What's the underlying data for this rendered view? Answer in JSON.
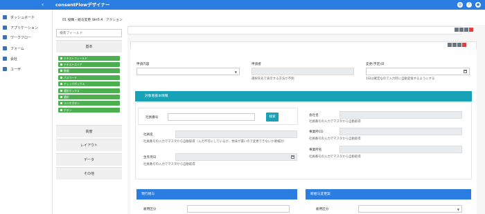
{
  "app": {
    "title": "consentFlowデザイナー"
  },
  "sidebar": {
    "items": [
      {
        "label": "ダッシュボード"
      },
      {
        "label": "アプリケーション"
      },
      {
        "label": "ワークフロー"
      },
      {
        "label": "フォーム"
      },
      {
        "label": "会社"
      },
      {
        "label": "ユーザ"
      }
    ]
  },
  "breadcrumb": {
    "form_name": "01 役職・給与変更 Ver0.4",
    "action": "アクション"
  },
  "palette": {
    "search_placeholder": "検索フィールド",
    "sections": {
      "basic": "基本",
      "advanced": "高度",
      "layout": "レイアウト",
      "data": "データ",
      "other": "その他"
    },
    "tools": [
      "テキストフィールド",
      "テキストエリア",
      "数値",
      "パスワード",
      "チェックボックス",
      "選択ボックス",
      "選択",
      "ラジオボタン",
      "ボタン"
    ]
  },
  "form": {
    "application_content": {
      "label": "申請内容"
    },
    "applicant": {
      "label": "申請者",
      "hint": "選択氏名で表示する方法が不明"
    },
    "change_date": {
      "label": "変更(予定)日",
      "hint": "1日は確定なので入力時に自動変換するようにする"
    },
    "employee_section": {
      "title": "対象者基本情報",
      "employee_no": {
        "label": "社員番号"
      },
      "search_button": "検索",
      "employee_name": {
        "label": "社員名",
        "hint": "社員番号の入力でマスタから自動取得（入力不可にしているが、色味が濃いので変更できないか要検討）"
      },
      "birth_date": {
        "label": "生年月日",
        "hint": "社員番号の入力でマスタから自動取得"
      },
      "company": {
        "label": "会社名",
        "hint": "社員番号の入力でマスタから自動取得"
      },
      "office_cd": {
        "label": "事業所CD",
        "hint": "社員番号の入力でマスタから自動取得"
      },
      "office_name": {
        "label": "事業所名",
        "hint": "社員番号の入力でマスタから自動取得"
      }
    },
    "current_salary": {
      "title": "現行給与",
      "employment_type": {
        "label": "雇用区分"
      }
    },
    "new_salary": {
      "title": "新給与変更案",
      "employment_type": {
        "label": "雇用区分"
      }
    }
  }
}
